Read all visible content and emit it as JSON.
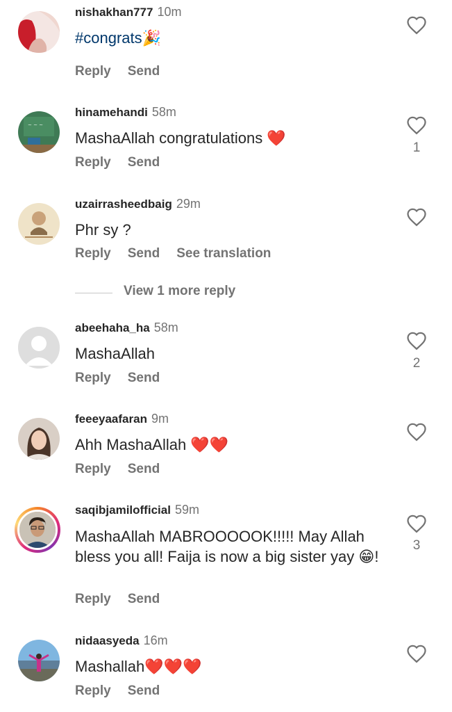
{
  "comments": [
    {
      "username": "nishakhan777",
      "time": "10m",
      "text": "#congrats🎉",
      "actions": [
        "Reply",
        "Send"
      ],
      "likes": "",
      "avatar": "red-hair-avatar"
    },
    {
      "username": "hinamehandi",
      "time": "58m",
      "text": "MashaAllah congratulations ❤️",
      "actions": [
        "Reply",
        "Send"
      ],
      "likes": "1",
      "avatar": "chalkboard-avatar"
    },
    {
      "username": "uzairrasheedbaig",
      "time": "29m",
      "text": "Phr sy ?",
      "actions": [
        "Reply",
        "Send",
        "See translation"
      ],
      "likes": "",
      "avatar": "portrait-card-avatar"
    },
    {
      "username": "abeehaha_ha",
      "time": "58m",
      "text": "MashaAllah",
      "actions": [
        "Reply",
        "Send"
      ],
      "likes": "2",
      "avatar": "default-avatar"
    },
    {
      "username": "feeeyaafaran",
      "time": "9m",
      "text": "Ahh MashaAllah ❤️❤️",
      "actions": [
        "Reply",
        "Send"
      ],
      "likes": "",
      "avatar": "woman-avatar"
    },
    {
      "username": "saqibjamilofficial",
      "time": "59m",
      "text": "MashaAllah MABROOOOOK!!!!! May Allah bless you all! Faija is now a big sister yay 😁!",
      "actions": [
        "Reply",
        "Send"
      ],
      "likes": "3",
      "avatar": "man-glasses-avatar"
    },
    {
      "username": "nidaasyeda",
      "time": "16m",
      "text": "Mashallah❤️❤️❤️",
      "actions": [
        "Reply",
        "Send"
      ],
      "likes": "",
      "avatar": "landscape-avatar"
    }
  ],
  "view_more": "View 1 more reply",
  "colors": {
    "text": "#262626",
    "secondary": "#737373",
    "hashtag": "#00376b",
    "heart": "#e0245e"
  }
}
